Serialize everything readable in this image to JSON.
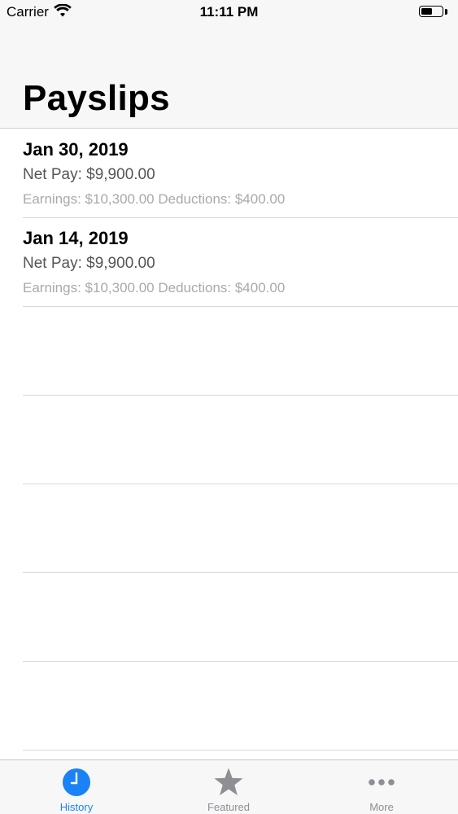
{
  "status_bar": {
    "carrier": "Carrier",
    "time": "11:11 PM",
    "battery_level": 0.55
  },
  "header": {
    "title": "Payslips"
  },
  "payslips": [
    {
      "date": "Jan 30, 2019",
      "net_pay": "Net Pay: $9,900.00",
      "detail": "Earnings: $10,300.00 Deductions: $400.00"
    },
    {
      "date": "Jan 14, 2019",
      "net_pay": "Net Pay: $9,900.00",
      "detail": "Earnings: $10,300.00 Deductions: $400.00"
    }
  ],
  "tab_bar": {
    "tabs": [
      {
        "label": "History",
        "icon": "clock-icon",
        "active": true
      },
      {
        "label": "Featured",
        "icon": "star-icon",
        "active": false
      },
      {
        "label": "More",
        "icon": "more-icon",
        "active": false
      }
    ]
  },
  "colors": {
    "accent": "#1a82f6",
    "inactive": "#8e8e93"
  }
}
